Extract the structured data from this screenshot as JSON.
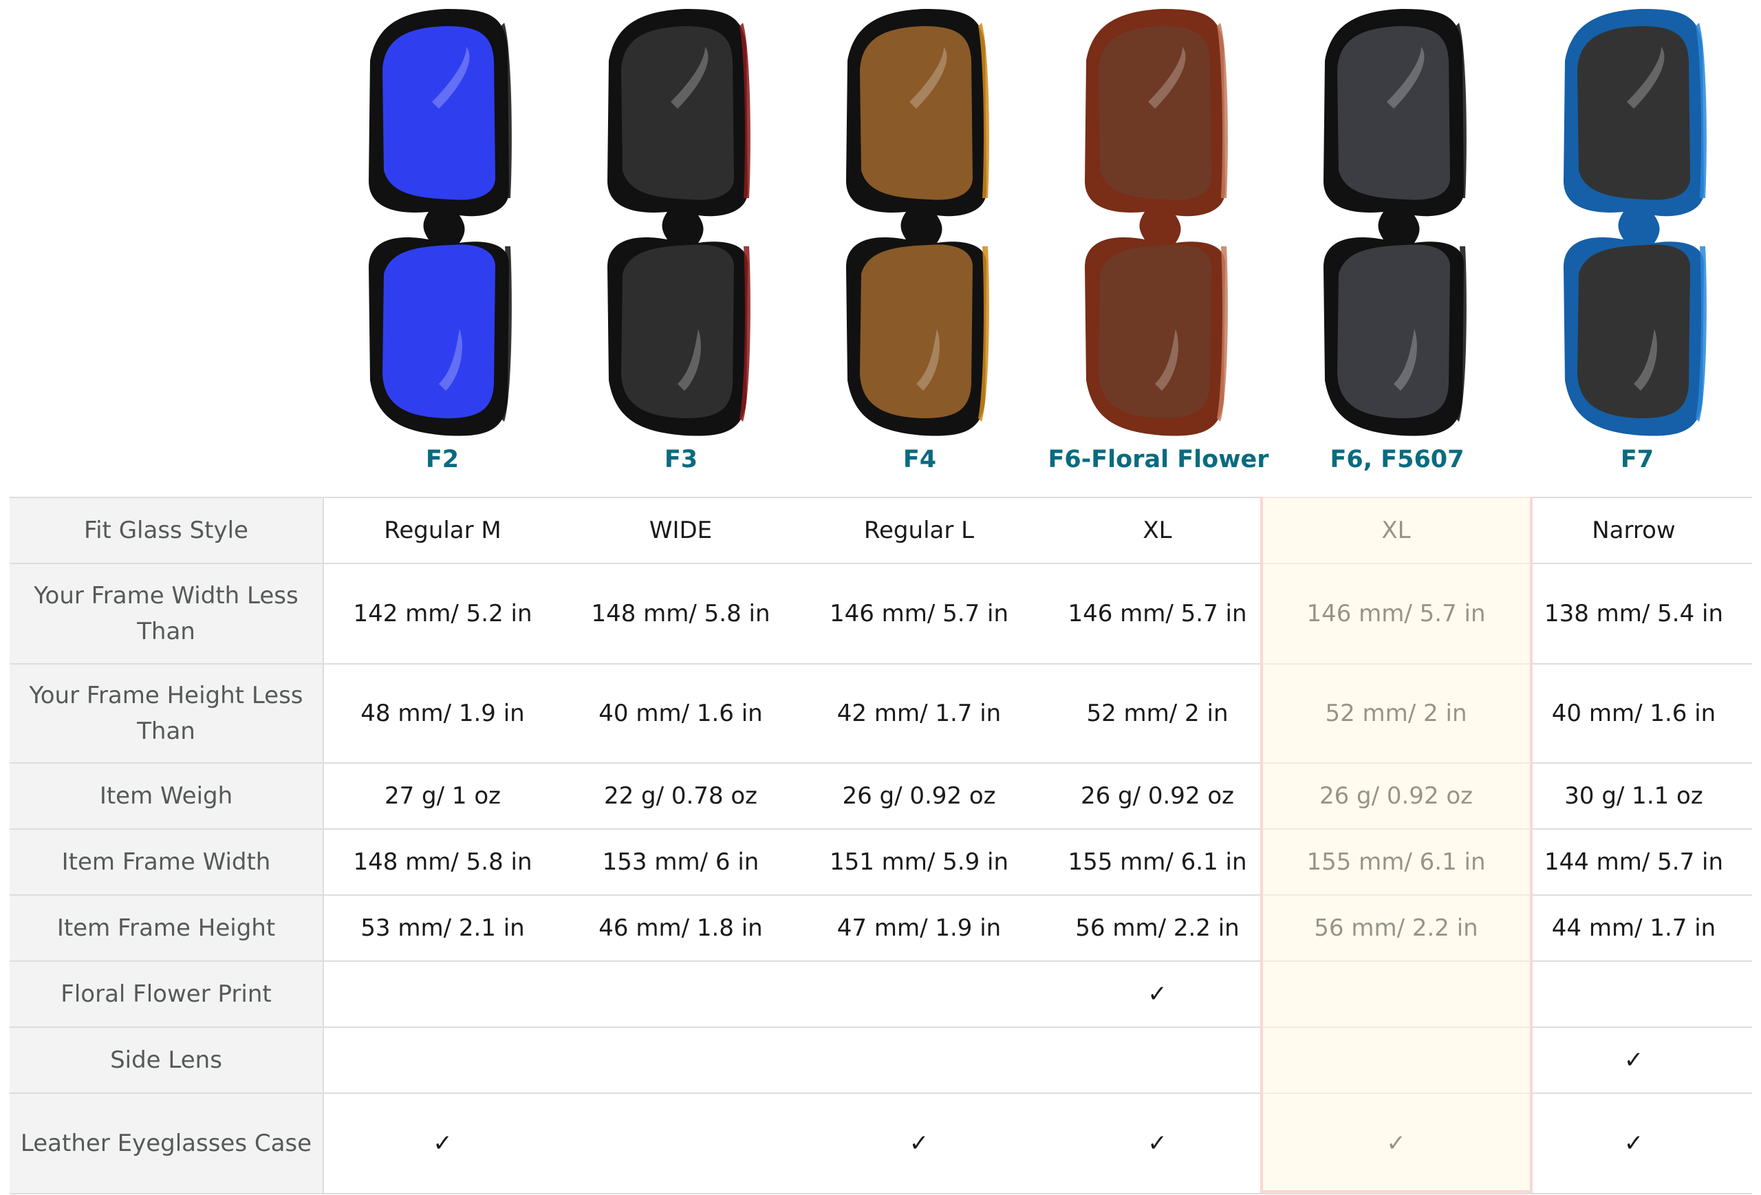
{
  "products": [
    {
      "name": "F2",
      "lens_color": "#2f3ff0",
      "frame_color": "#111111",
      "edge_color": "#111111"
    },
    {
      "name": "F3",
      "lens_color": "#2e2e2e",
      "frame_color": "#111111",
      "edge_color": "#8a1a1a"
    },
    {
      "name": "F4",
      "lens_color": "#8a5a28",
      "frame_color": "#111111",
      "edge_color": "#d08a1c"
    },
    {
      "name": "F6-Floral Flower",
      "lens_color": "#6e3a25",
      "frame_color": "#7a2d17",
      "edge_color": "#c47a5a"
    },
    {
      "name": "F6, F5607",
      "lens_color": "#3b3d42",
      "frame_color": "#111111",
      "edge_color": "#111111"
    },
    {
      "name": "F7",
      "lens_color": "#333333",
      "frame_color": "#1560a8",
      "edge_color": "#2a86d8"
    }
  ],
  "rows": [
    {
      "label": "Fit Glass Style",
      "values": [
        "Regular M",
        "WIDE",
        "Regular L",
        "XL",
        "XL",
        "Narrow"
      ]
    },
    {
      "label": "Your Frame Width Less Than",
      "values": [
        "142 mm/ 5.2 in",
        "148 mm/ 5.8 in",
        "146 mm/ 5.7 in",
        "146 mm/ 5.7 in",
        "146 mm/ 5.7 in",
        "138 mm/ 5.4 in"
      ]
    },
    {
      "label": "Your Frame Height Less Than",
      "values": [
        "48 mm/ 1.9 in",
        "40 mm/ 1.6 in",
        "42 mm/ 1.7 in",
        "52 mm/ 2 in",
        "52 mm/ 2 in",
        "40 mm/ 1.6 in"
      ]
    },
    {
      "label": "Item Weigh",
      "values": [
        "27 g/ 1 oz",
        "22 g/ 0.78 oz",
        "26 g/ 0.92 oz",
        "26 g/ 0.92 oz",
        "26 g/ 0.92 oz",
        "30 g/ 1.1 oz"
      ]
    },
    {
      "label": "Item Frame Width",
      "values": [
        "148 mm/ 5.8 in",
        "153 mm/ 6 in",
        "151 mm/ 5.9 in",
        "155 mm/ 6.1 in",
        "155 mm/ 6.1 in",
        "144 mm/ 5.7 in"
      ]
    },
    {
      "label": "Item Frame Height",
      "values": [
        "53 mm/ 2.1 in",
        "46 mm/ 1.8 in",
        "47 mm/ 1.9 in",
        "56 mm/ 2.2 in",
        "56 mm/ 2.2 in",
        "44 mm/ 1.7 in"
      ]
    },
    {
      "label": "Floral Flower Print",
      "values": [
        "",
        "",
        "",
        "✓",
        "",
        ""
      ]
    },
    {
      "label": "Side Lens",
      "values": [
        "",
        "",
        "",
        "",
        "",
        "✓"
      ]
    },
    {
      "label": "Leather Eyeglasses Case",
      "values": [
        "✓",
        "",
        "✓",
        "✓",
        "✓",
        "✓"
      ]
    }
  ],
  "highlighted_column": 4,
  "highlight_color": "#fff8e1",
  "highlight_border_color": "#fad6d6"
}
